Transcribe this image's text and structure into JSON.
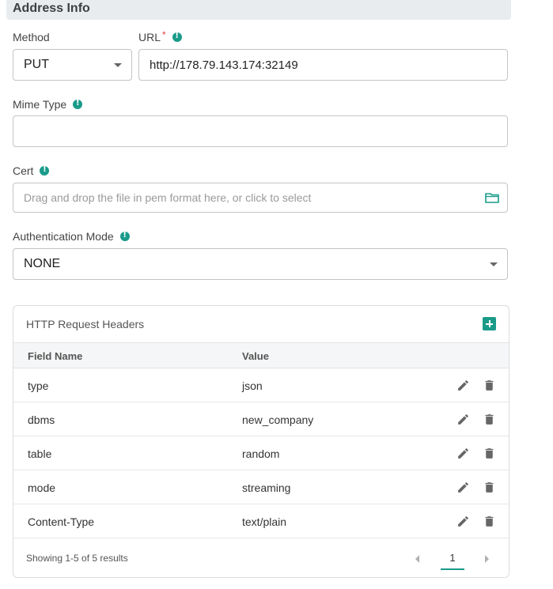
{
  "section": {
    "title": "Address Info"
  },
  "method": {
    "label": "Method",
    "value": "PUT"
  },
  "url": {
    "label": "URL",
    "required": "*",
    "value": "http://178.79.143.174:32149"
  },
  "mime": {
    "label": "Mime Type",
    "value": ""
  },
  "cert": {
    "label": "Cert",
    "placeholder": "Drag and drop the file in pem format here, or click to select"
  },
  "auth": {
    "label": "Authentication Mode",
    "value": "NONE"
  },
  "headers": {
    "title": "HTTP Request Headers",
    "columns": [
      "Field Name",
      "Value"
    ],
    "rows": [
      {
        "field": "type",
        "value": "json"
      },
      {
        "field": "dbms",
        "value": "new_company"
      },
      {
        "field": "table",
        "value": "random"
      },
      {
        "field": "mode",
        "value": "streaming"
      },
      {
        "field": "Content-Type",
        "value": "text/plain"
      }
    ],
    "footer": "Showing 1-5 of 5 results",
    "page": "1"
  },
  "colors": {
    "accent": "#1a9b8a",
    "header_bg": "#e8ecef",
    "border": "#c4c4c4"
  },
  "icons": [
    "info-icon",
    "caret-down-icon",
    "folder-icon",
    "add-icon",
    "edit-icon",
    "delete-icon",
    "chevron-left-icon",
    "chevron-right-icon"
  ]
}
